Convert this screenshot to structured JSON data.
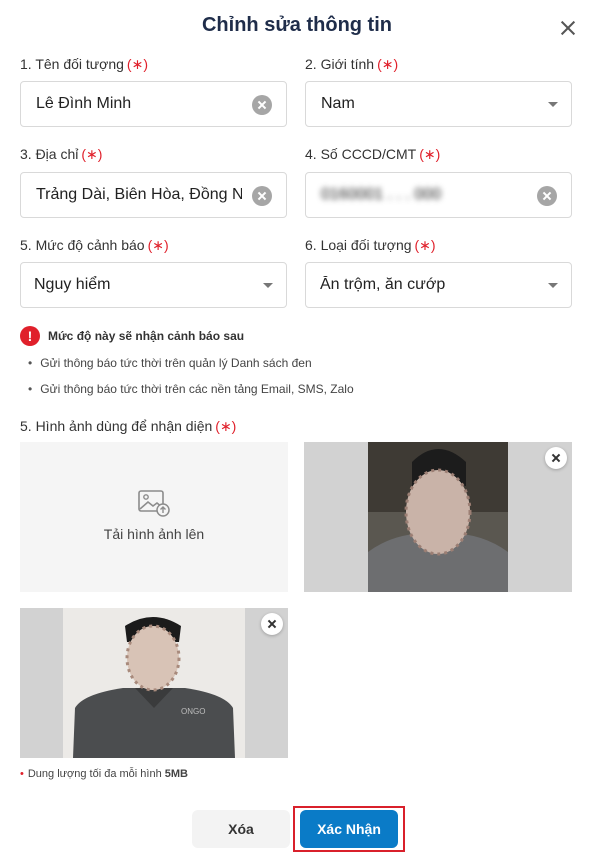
{
  "dialog": {
    "title": "Chỉnh sửa thông tin",
    "required_mark": "(∗)"
  },
  "fields": {
    "name": {
      "label": "1. Tên đối tượng",
      "value": "Lê Đình Minh"
    },
    "gender": {
      "label": "2. Giới tính",
      "value": "Nam"
    },
    "address": {
      "label": "3. Địa chỉ",
      "value": "Trảng Dài, Biên Hòa, Đồng Nai"
    },
    "id_number": {
      "label": "4. Số CCCD/CMT",
      "value": "0160001 . . . 000"
    },
    "alert_level": {
      "label": "5. Mức độ cảnh báo",
      "value": "Nguy hiểm"
    },
    "subject_type": {
      "label": "6. Loại đối tượng",
      "value": "Ăn trộm, ăn cướp"
    }
  },
  "warning": {
    "title": "Mức độ này sẽ nhận cảnh báo sau",
    "items": [
      "Gửi thông báo tức thời trên quản lý Danh sách đen",
      "Gửi thông báo tức thời trên các nền tảng Email, SMS, Zalo"
    ],
    "icon": "exclamation-icon",
    "color": "#e0202b"
  },
  "images": {
    "label": "5. Hình ảnh dùng để nhận diện",
    "upload_text": "Tải hình ảnh lên",
    "note_prefix": "Dung lượng tối đa mỗi hình",
    "note_size": "5MB",
    "shirt_logo": "ONGO"
  },
  "actions": {
    "delete": "Xóa",
    "confirm": "Xác Nhận"
  },
  "colors": {
    "primary": "#0a7bc7",
    "required": "#e0202b",
    "title": "#1f2d4a"
  }
}
